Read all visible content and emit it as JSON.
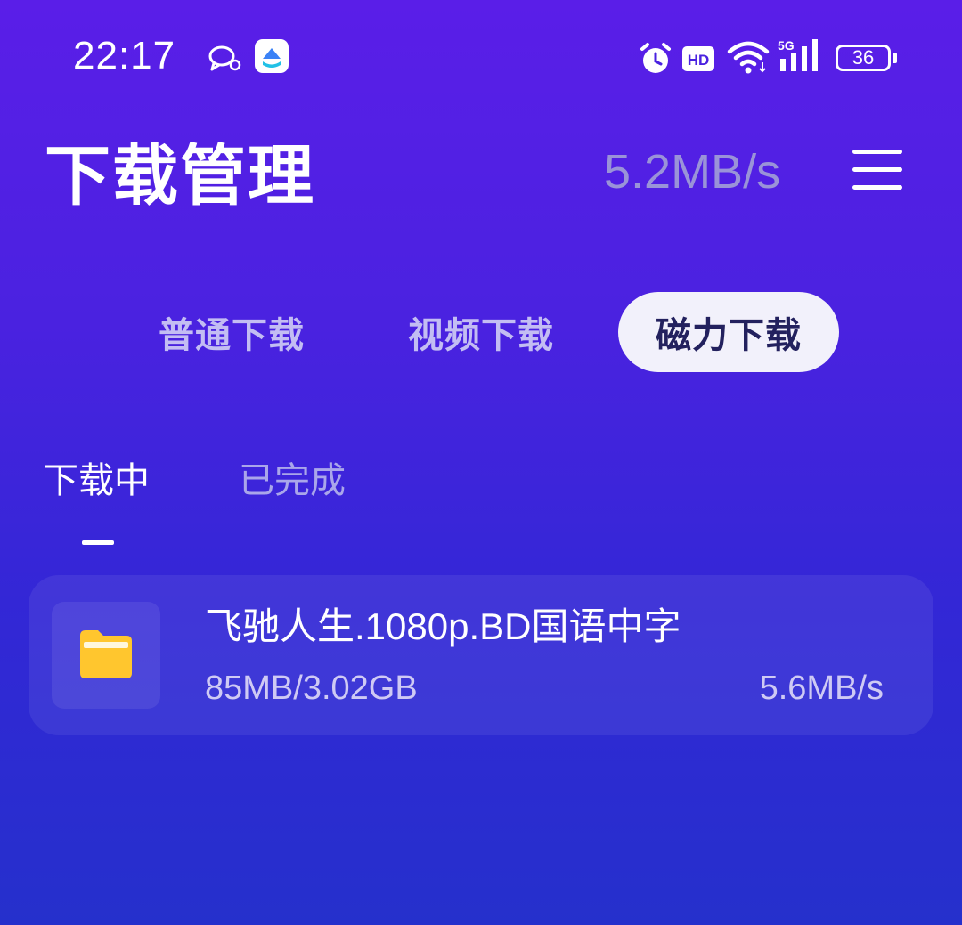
{
  "status_bar": {
    "time": "22:17",
    "battery": "36",
    "network": "5G",
    "icons": [
      "chat-icon",
      "app-icon",
      "alarm-icon",
      "hd-icon",
      "wifi-icon",
      "signal-icon",
      "battery-icon"
    ]
  },
  "header": {
    "title": "下载管理",
    "speed": "5.2MB/s",
    "menu_icon": "menu-icon"
  },
  "category_tabs": [
    {
      "label": "普通下载",
      "selected": false
    },
    {
      "label": "视频下载",
      "selected": false
    },
    {
      "label": "磁力下载",
      "selected": true
    }
  ],
  "sub_tabs": [
    {
      "label": "下载中",
      "selected": true
    },
    {
      "label": "已完成",
      "selected": false
    }
  ],
  "downloads": [
    {
      "name": "飞驰人生.1080p.BD国语中字",
      "progress": "85MB/3.02GB",
      "speed": "5.6MB/s",
      "icon": "folder-icon"
    }
  ],
  "colors": {
    "background_top": "#5a1ee8",
    "background_bottom": "#2530cc",
    "selected_tab_bg": "#f2f1fb",
    "selected_tab_text": "#23215e",
    "folder": "#ffc62e"
  }
}
